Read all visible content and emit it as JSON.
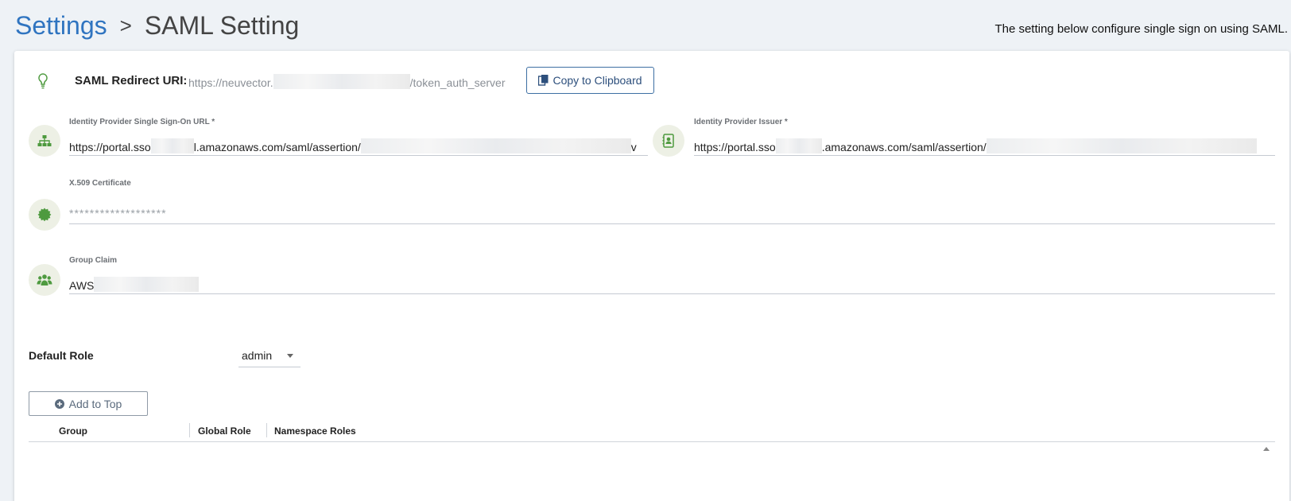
{
  "breadcrumb": {
    "parent": "Settings",
    "separator": ">",
    "current": "SAML Setting"
  },
  "header": {
    "description": "The setting below configure single sign on using SAML."
  },
  "redirect": {
    "label": "SAML Redirect URI:",
    "uri_prefix": "https://neuvector.",
    "uri_suffix": "/token_auth_server",
    "copy_label": "Copy to Clipboard"
  },
  "fields": {
    "sso_url": {
      "label": "Identity Provider Single Sign-On URL *",
      "value_a": "https://portal.sso",
      "value_b": "l.amazonaws.com/saml/assertion/",
      "value_c": "v"
    },
    "issuer": {
      "label": "Identity Provider Issuer *",
      "value_a": "https://portal.sso",
      "value_b": ".amazonaws.com/saml/assertion/"
    },
    "certificate": {
      "label": "X.509 Certificate",
      "value": "*******************"
    },
    "group_claim": {
      "label": "Group Claim",
      "value": "AWS"
    }
  },
  "role": {
    "label": "Default Role",
    "value": "admin"
  },
  "add_button": {
    "label": "Add to Top"
  },
  "table": {
    "columns": [
      "Group",
      "Global Role",
      "Namespace Roles"
    ]
  },
  "colors": {
    "accent": "#2f74c0",
    "icon_green": "#4e9a3f",
    "icon_bg": "#edf0e5"
  }
}
